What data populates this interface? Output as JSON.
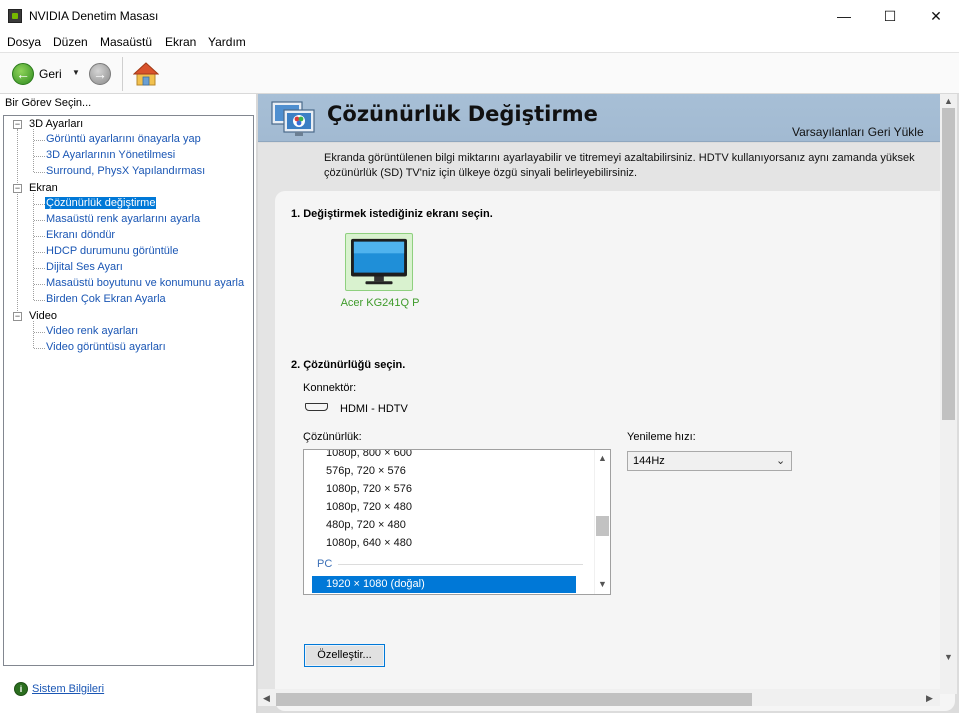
{
  "window": {
    "title": "NVIDIA Denetim Masası",
    "minimize": "—",
    "maximize": "☐",
    "close": "✕"
  },
  "menu": [
    "Dosya",
    "Düzen",
    "Masaüstü",
    "Ekran",
    "Yardım"
  ],
  "toolbar": {
    "back_label": "Geri"
  },
  "left_panel": {
    "header": "Bir Görev Seçin...",
    "tree": [
      {
        "label": "3D Ayarları",
        "children": [
          "Görüntü ayarlarını önayarla yap",
          "3D Ayarlarının Yönetilmesi",
          "Surround, PhysX Yapılandırması"
        ]
      },
      {
        "label": "Ekran",
        "children": [
          "Çözünürlük değiştirme",
          "Masaüstü renk ayarlarını ayarla",
          "Ekranı döndür",
          "HDCP durumunu görüntüle",
          "Dijital Ses Ayarı",
          "Masaüstü boyutunu ve konumunu ayarla",
          "Birden Çok Ekran Ayarla"
        ]
      },
      {
        "label": "Video",
        "children": [
          "Video renk ayarları",
          "Video görüntüsü ayarları"
        ]
      }
    ],
    "selected": "Çözünürlük değiştirme",
    "system_info_link": "Sistem Bilgileri"
  },
  "page": {
    "title": "Çözünürlük Değiştirme",
    "restore_defaults": "Varsayılanları Geri Yükle",
    "intro": "Ekranda görüntülenen bilgi miktarını ayarlayabilir ve titremeyi azaltabilirsiniz. HDTV kullanıyorsanız aynı zamanda yüksek çözünürlük (SD) TV'niz için ülkeye özgü sinyali belirleyebilirsiniz.",
    "step1": "1. Değiştirmek istediğiniz ekranı seçin.",
    "monitor_name": "Acer KG241Q P",
    "step2": "2. Çözünürlüğü seçin.",
    "connector_label": "Konnektör:",
    "connector_value": "HDMI - HDTV",
    "resolution_label": "Çözünürlük:",
    "resolution_items": [
      "1080p, 800 × 600",
      "576p, 720 × 576",
      "1080p, 720 × 576",
      "1080p, 720 × 480",
      "480p, 720 × 480",
      "1080p, 640 × 480"
    ],
    "resolution_group": "PC",
    "resolution_selected": "1920 × 1080 (doğal)",
    "refresh_label": "Yenileme hızı:",
    "refresh_value": "144Hz",
    "customize_button": "Özelleştir..."
  },
  "colors": {
    "nvidia_green": "#76b900",
    "selection": "#0078d7",
    "link": "#1a56b4",
    "banner": "#a7bfd6"
  }
}
